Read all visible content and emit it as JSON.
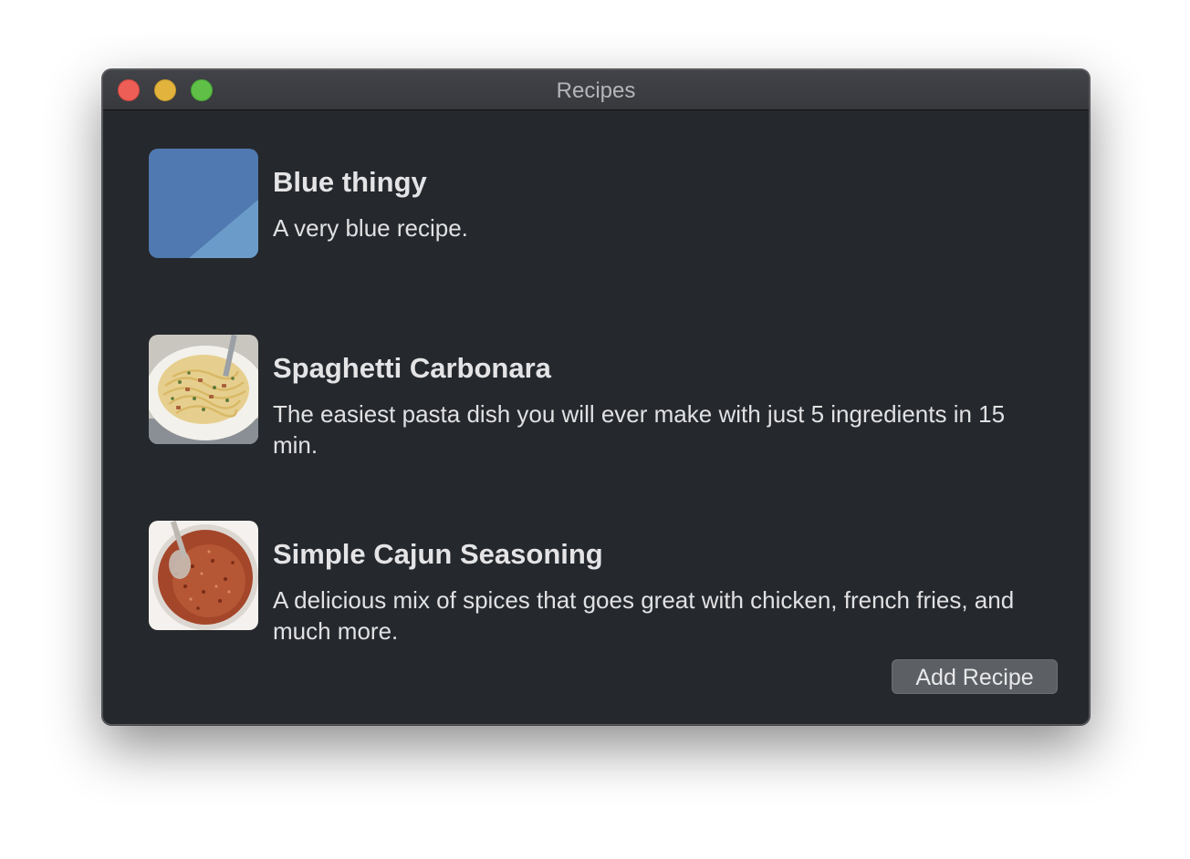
{
  "window": {
    "title": "Recipes"
  },
  "recipes": [
    {
      "title": "Blue thingy",
      "description": "A very blue recipe.",
      "image": "blue-placeholder-image"
    },
    {
      "title": "Spaghetti Carbonara",
      "description": "The easiest pasta dish you will ever make with just 5 ingredients in 15 min.",
      "image": "spaghetti-carbonara-photo"
    },
    {
      "title": "Simple Cajun Seasoning",
      "description": "A delicious mix of spices that goes great with chicken, french fries, and much more.",
      "image": "cajun-seasoning-photo"
    }
  ],
  "actions": {
    "add_recipe_label": "Add Recipe"
  },
  "colors": {
    "window_bg": "#25282c",
    "titlebar": "#3c3e42",
    "button_bg": "#5c5f63",
    "close": "#ed5e57",
    "minimize": "#e2b43d",
    "maximize": "#5fbf47"
  }
}
